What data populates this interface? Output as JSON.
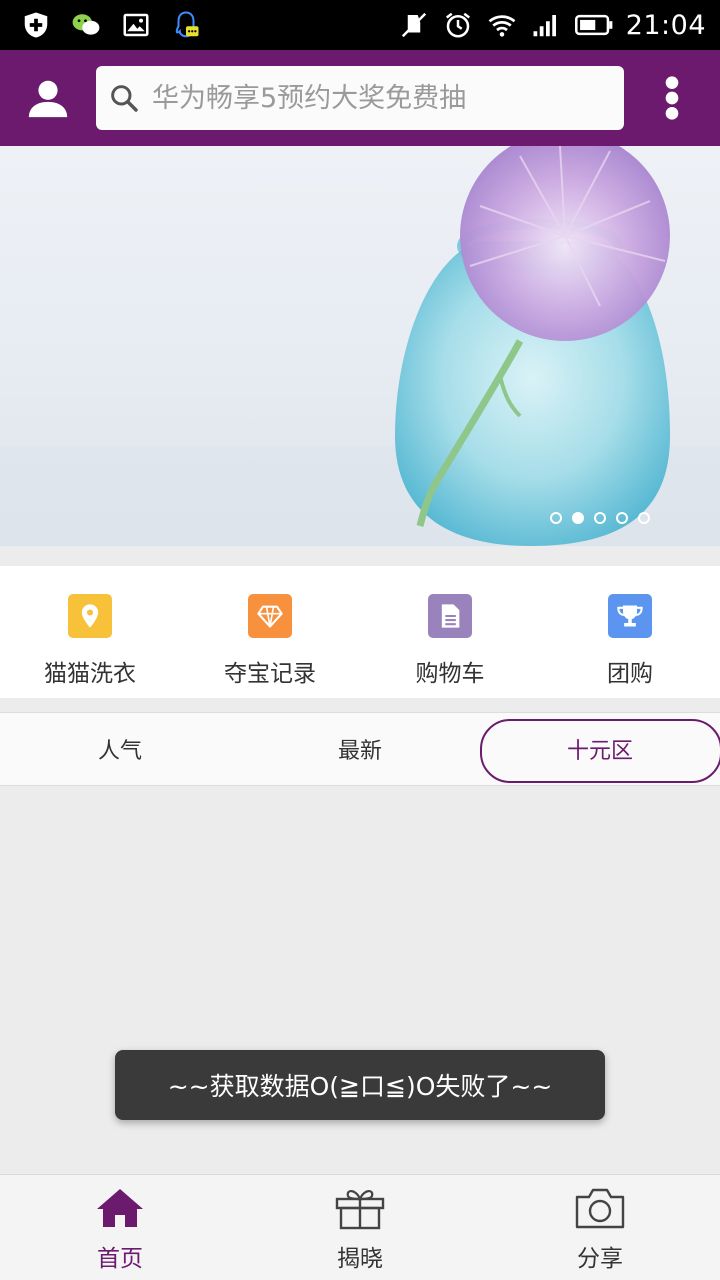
{
  "status_bar": {
    "time": "21:04",
    "icons": [
      "shield-plus-icon",
      "wechat-icon",
      "image-icon",
      "qq-icon",
      "mute-icon",
      "alarm-icon",
      "wifi-icon",
      "signal-icon",
      "battery-icon"
    ]
  },
  "header": {
    "avatar_icon": "user-icon",
    "search_placeholder": "华为畅享5预约大奖免费抽",
    "more_icon": "more-vertical-icon",
    "bg_color": "#6b1a6e"
  },
  "banner": {
    "slide_count": 5,
    "active_slide": 2
  },
  "quick_menu": [
    {
      "label": "猫猫洗衣",
      "icon": "location-pin-icon",
      "color": "#f7c23a"
    },
    {
      "label": "夺宝记录",
      "icon": "diamond-icon",
      "color": "#f7913d"
    },
    {
      "label": "购物车",
      "icon": "document-icon",
      "color": "#9a83bd"
    },
    {
      "label": "团购",
      "icon": "trophy-icon",
      "color": "#5c95ef"
    }
  ],
  "tabs": [
    {
      "label": "人气",
      "active": false
    },
    {
      "label": "最新",
      "active": false
    },
    {
      "label": "十元区",
      "active": true
    }
  ],
  "toast": {
    "message": "~~获取数据O(≧口≦)O失败了~~"
  },
  "bottom_nav": [
    {
      "label": "首页",
      "icon": "home-icon",
      "active": true
    },
    {
      "label": "揭晓",
      "icon": "gift-icon",
      "active": false
    },
    {
      "label": "分享",
      "icon": "camera-icon",
      "active": false
    }
  ],
  "colors": {
    "accent": "#6b1a6e",
    "background": "#ececec"
  }
}
